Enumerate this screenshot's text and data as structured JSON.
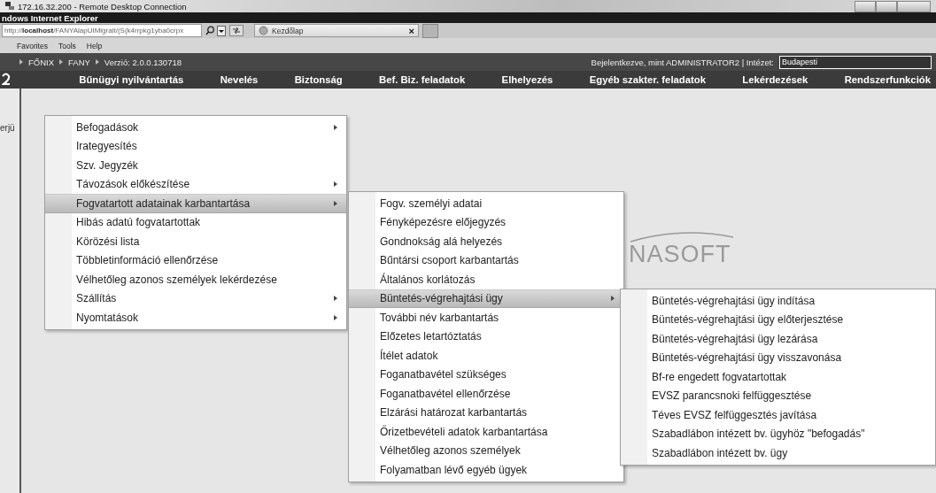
{
  "remote_window": {
    "title": "172.16.32.200 - Remote Desktop Connection"
  },
  "browser": {
    "title": "ndows Internet Explorer",
    "address": "http://**localhost**/FANYAlapUIMigralt/(S(k4rrpkg1yba0crpx",
    "tab": {
      "label": "Kezdőlap",
      "close": "×"
    },
    "menu": [
      "Favorites",
      "Tools",
      "Help"
    ]
  },
  "app": {
    "breadcrumb": [
      "FŐNIX",
      "FANY",
      "Verzió: 2.0.0.130718"
    ],
    "login_text": "Bejelentkezve, mint ADMINISTRATOR2 | Intézet:",
    "institution": "Budapesti",
    "nav": [
      "Bűnügyi nyilvántartás",
      "Nevelés",
      "Biztonság",
      "Bef. Biz. feladatok",
      "Elhelyezés",
      "Egyéb szakter. feladatok",
      "Lekérdezések",
      "Rendszerfunkciók"
    ],
    "content_text": "erjü",
    "logo": "NASOFT"
  },
  "menus": [
    {
      "items": [
        {
          "label": "Befogadások",
          "submenu": true,
          "selected": false
        },
        {
          "label": "Irategyesítés",
          "submenu": false,
          "selected": false
        },
        {
          "label": "Szv. Jegyzék",
          "submenu": false,
          "selected": false
        },
        {
          "label": "Távozások előkészítése",
          "submenu": true,
          "selected": false
        },
        {
          "label": "Fogvatartott adatainak karbantartása",
          "submenu": true,
          "selected": true
        },
        {
          "label": "Hibás adatú fogvatartottak",
          "submenu": false,
          "selected": false
        },
        {
          "label": "Körözési lista",
          "submenu": false,
          "selected": false
        },
        {
          "label": "Többletinformáció ellenőrzése",
          "submenu": false,
          "selected": false
        },
        {
          "label": "Vélhetőleg azonos személyek lekérdezése",
          "submenu": false,
          "selected": false
        },
        {
          "label": "Szállítás",
          "submenu": true,
          "selected": false
        },
        {
          "label": "Nyomtatások",
          "submenu": true,
          "selected": false
        }
      ]
    },
    {
      "items": [
        {
          "label": "Fogv. személyi adatai",
          "submenu": false,
          "selected": false
        },
        {
          "label": "Fényképezésre előjegyzés",
          "submenu": false,
          "selected": false
        },
        {
          "label": "Gondnokság alá helyezés",
          "submenu": false,
          "selected": false
        },
        {
          "label": "Bűntársi csoport karbantartás",
          "submenu": false,
          "selected": false
        },
        {
          "label": "Általános korlátozás",
          "submenu": false,
          "selected": false
        },
        {
          "label": "Büntetés-végrehajtási ügy",
          "submenu": true,
          "selected": true
        },
        {
          "label": "További név karbantartás",
          "submenu": false,
          "selected": false
        },
        {
          "label": "Előzetes letartóztatás",
          "submenu": false,
          "selected": false
        },
        {
          "label": "Ítélet adatok",
          "submenu": false,
          "selected": false
        },
        {
          "label": "Foganatbavétel szükséges",
          "submenu": false,
          "selected": false
        },
        {
          "label": "Foganatbavétel ellenőrzése",
          "submenu": false,
          "selected": false
        },
        {
          "label": "Elzárási határozat karbantartás",
          "submenu": false,
          "selected": false
        },
        {
          "label": "Őrizetbevételi adatok karbantartása",
          "submenu": false,
          "selected": false
        },
        {
          "label": "Vélhetőleg azonos személyek",
          "submenu": false,
          "selected": false
        },
        {
          "label": "Folyamatban lévő egyéb ügyek",
          "submenu": false,
          "selected": false
        }
      ]
    },
    {
      "items": [
        {
          "label": "Büntetés-végrehajtási ügy indítása",
          "submenu": false,
          "selected": false
        },
        {
          "label": "Büntetés-végrehajtási ügy előterjesztése",
          "submenu": false,
          "selected": false
        },
        {
          "label": "Büntetés-végrehajtási ügy lezárása",
          "submenu": false,
          "selected": false
        },
        {
          "label": "Büntetés-végrehajtási ügy visszavonása",
          "submenu": false,
          "selected": false
        },
        {
          "label": "Bf-re engedett fogvatartottak",
          "submenu": false,
          "selected": false
        },
        {
          "label": "EVSZ parancsnoki felfüggesztése",
          "submenu": false,
          "selected": false
        },
        {
          "label": "Téves EVSZ felfüggesztés javítása",
          "submenu": false,
          "selected": false
        },
        {
          "label": "Szabadlábon intézett bv. ügyhöz \"befogadás\"",
          "submenu": false,
          "selected": false
        },
        {
          "label": "Szabadlábon intézett bv. ügy",
          "submenu": false,
          "selected": false
        }
      ]
    }
  ]
}
